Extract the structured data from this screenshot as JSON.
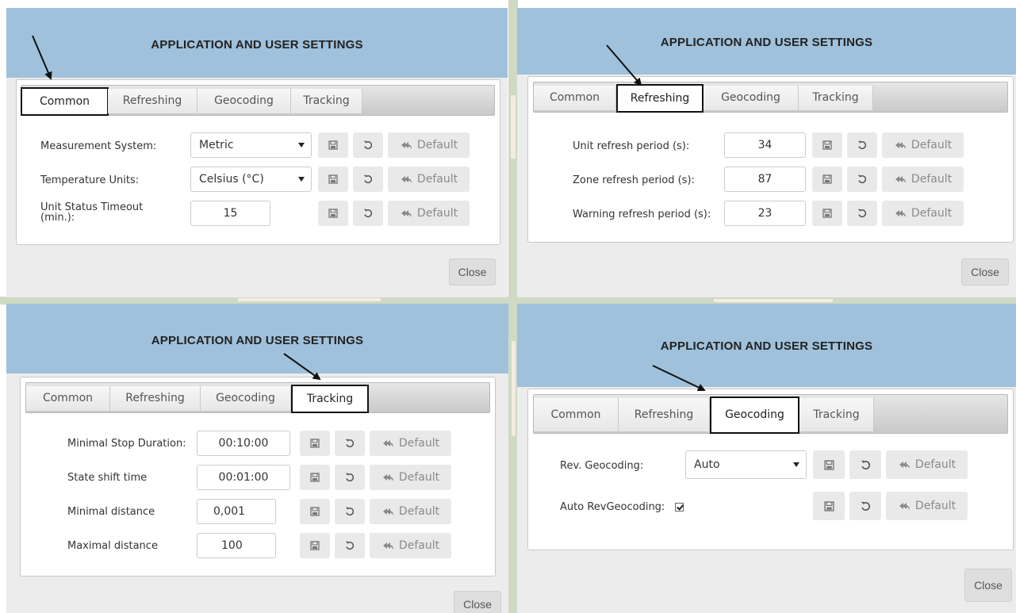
{
  "title": "APPLICATION AND USER SETTINGS",
  "tabs": [
    "Common",
    "Refreshing",
    "Geocoding",
    "Tracking"
  ],
  "default_label": "Default",
  "close_label": "Close",
  "common": {
    "rows": [
      {
        "label": "Measurement System:",
        "value": "Metric"
      },
      {
        "label": "Temperature Units:",
        "value": "Celsius (°C)"
      },
      {
        "label": "Unit Status Timeout (min.):",
        "value": "15"
      }
    ]
  },
  "refreshing": {
    "rows": [
      {
        "label": "Unit refresh period (s):",
        "value": "34"
      },
      {
        "label": "Zone refresh period (s):",
        "value": "87"
      },
      {
        "label": "Warning refresh period (s):",
        "value": "23"
      }
    ]
  },
  "tracking": {
    "rows": [
      {
        "label": "Minimal Stop Duration:",
        "value": "00:10:00"
      },
      {
        "label": "State shift time",
        "value": "00:01:00"
      },
      {
        "label": "Minimal distance",
        "value": "0,001"
      },
      {
        "label": "Maximal distance",
        "value": "100"
      }
    ]
  },
  "geocoding": {
    "rows": [
      {
        "label": "Rev. Geocoding:",
        "value": "Auto"
      },
      {
        "label": "Auto RevGeocoding:",
        "checked": true
      }
    ]
  },
  "colors": {
    "header": "#9fc1db",
    "active_tab_border": "#111111"
  }
}
